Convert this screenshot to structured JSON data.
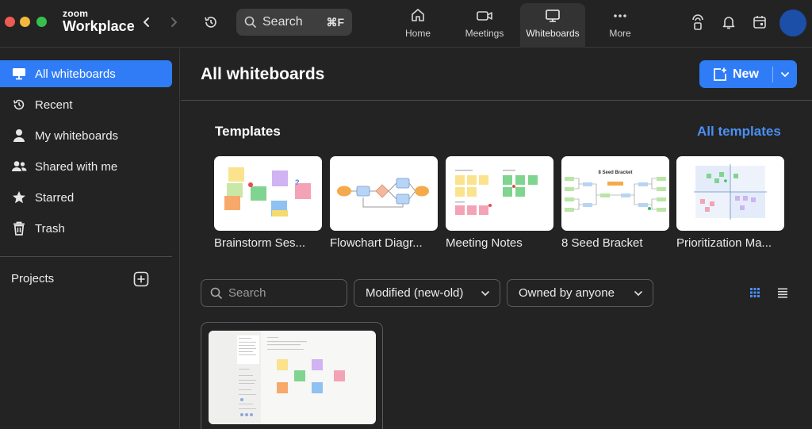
{
  "app": {
    "brand_small": "zoom",
    "brand_big": "Workplace"
  },
  "search": {
    "label": "Search",
    "shortcut": "⌘F"
  },
  "tabs": [
    {
      "label": "Home",
      "icon": "home-icon"
    },
    {
      "label": "Meetings",
      "icon": "video-camera-icon"
    },
    {
      "label": "Whiteboards",
      "icon": "whiteboard-icon",
      "active": true
    },
    {
      "label": "More",
      "icon": "more-dots-icon"
    }
  ],
  "sidebar": {
    "items": [
      {
        "label": "All whiteboards",
        "icon": "whiteboard-icon",
        "active": true
      },
      {
        "label": "Recent",
        "icon": "clock-history-icon"
      },
      {
        "label": "My whiteboards",
        "icon": "person-icon"
      },
      {
        "label": "Shared with me",
        "icon": "people-icon"
      },
      {
        "label": "Starred",
        "icon": "star-icon"
      },
      {
        "label": "Trash",
        "icon": "trash-icon"
      }
    ],
    "projects_label": "Projects"
  },
  "main": {
    "title": "All whiteboards",
    "new_button": "New",
    "templates_title": "Templates",
    "all_templates_link": "All templates",
    "templates": [
      {
        "name": "Brainstorm Ses..."
      },
      {
        "name": "Flowchart Diagr..."
      },
      {
        "name": "Meeting Notes"
      },
      {
        "name": "8 Seed Bracket"
      },
      {
        "name": "Prioritization Ma..."
      }
    ],
    "bracket_thumb_title": "8 Seed Bracket",
    "filters": {
      "search_placeholder": "Search",
      "sort": "Modified (new-old)",
      "owner": "Owned by anyone"
    }
  },
  "colors": {
    "accent": "#2f7cf6",
    "link": "#4a8ff5",
    "background": "#232323"
  }
}
